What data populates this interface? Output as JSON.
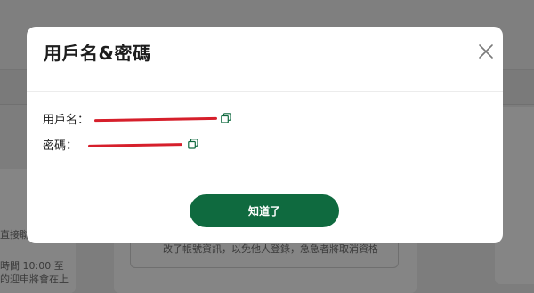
{
  "modal": {
    "title": "用戶名&密碼",
    "username_label": "用戶名：",
    "password_label": "密碼：",
    "ok_label": "知道了"
  },
  "background": {
    "left_lines": [
      "直接聯絡",
      "時間 10:00 至",
      "的迎申將會在上"
    ],
    "center_text": "改子帳號資訊，以免他人登錄，急急者將取消資格"
  },
  "colors": {
    "accent": "#0f6a3f",
    "redaction": "#d61f2b",
    "overlay": "#7d7d7d"
  },
  "icons": {
    "close": "close-icon",
    "copy": "copy-icon"
  }
}
